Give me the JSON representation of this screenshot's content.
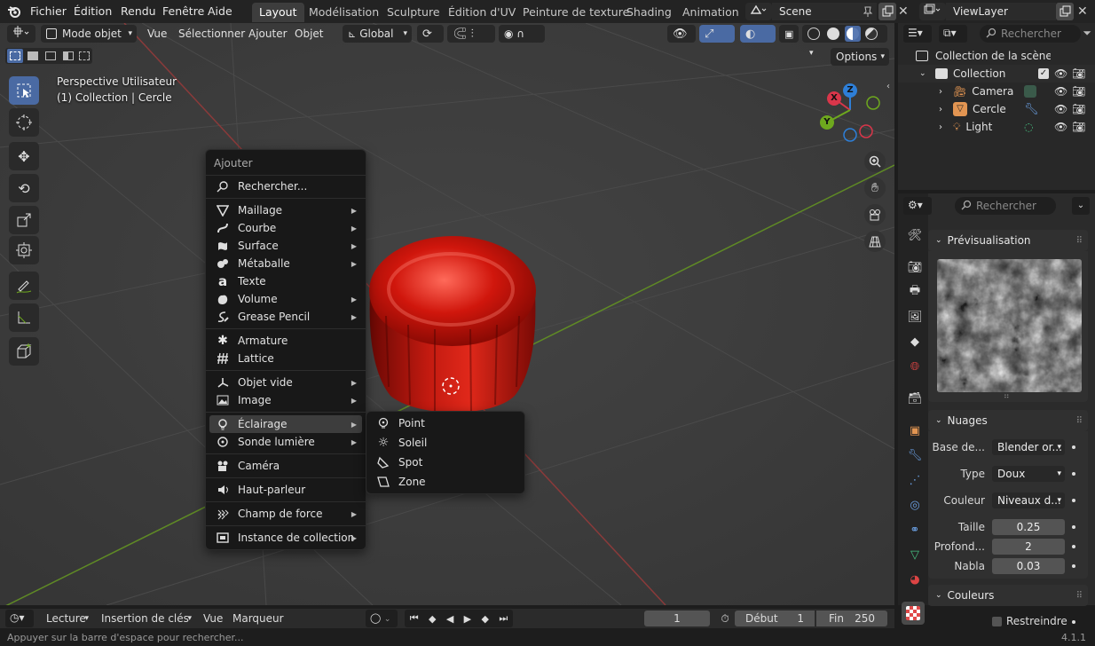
{
  "topbar": {
    "menus": [
      "Fichier",
      "Édition",
      "Rendu",
      "Fenêtre",
      "Aide"
    ],
    "workspaces": [
      "Layout",
      "Modélisation",
      "Sculpture",
      "Édition d'UV",
      "Peinture de texture",
      "Shading",
      "Animation"
    ],
    "active_workspace": "Layout",
    "scene": "Scene",
    "view_layer": "ViewLayer"
  },
  "viewport_header": {
    "mode": "Mode objet",
    "menus": [
      "Vue",
      "Sélectionner",
      "Ajouter",
      "Objet"
    ],
    "orientation": "Global",
    "options": "Options"
  },
  "viewport": {
    "info_line1": "Perspective Utilisateur",
    "info_line2": "(1) Collection | Cercle",
    "gizmo": {
      "x": "X",
      "y": "Y",
      "z": "Z"
    }
  },
  "add_menu": {
    "title": "Ajouter",
    "search": "Rechercher...",
    "items": [
      {
        "label": "Maillage",
        "icon": "mesh-icon",
        "submenu": true
      },
      {
        "label": "Courbe",
        "icon": "curve-icon",
        "submenu": true
      },
      {
        "label": "Surface",
        "icon": "surface-icon",
        "submenu": true
      },
      {
        "label": "Métaballe",
        "icon": "metaball-icon",
        "submenu": true
      },
      {
        "label": "Texte",
        "icon": "text-icon",
        "submenu": false
      },
      {
        "label": "Volume",
        "icon": "volume-icon",
        "submenu": true
      },
      {
        "label": "Grease Pencil",
        "icon": "grease-pencil-icon",
        "submenu": true
      },
      {
        "label": "Armature",
        "icon": "armature-icon",
        "submenu": false
      },
      {
        "label": "Lattice",
        "icon": "lattice-icon",
        "submenu": false
      },
      {
        "label": "Objet vide",
        "icon": "empty-icon",
        "submenu": true
      },
      {
        "label": "Image",
        "icon": "image-icon",
        "submenu": true
      },
      {
        "label": "Éclairage",
        "icon": "light-icon",
        "submenu": true
      },
      {
        "label": "Sonde lumière",
        "icon": "light-probe-icon",
        "submenu": true
      },
      {
        "label": "Caméra",
        "icon": "camera-icon",
        "submenu": false
      },
      {
        "label": "Haut-parleur",
        "icon": "speaker-icon",
        "submenu": false
      },
      {
        "label": "Champ de force",
        "icon": "force-field-icon",
        "submenu": true
      },
      {
        "label": "Instance de collection",
        "icon": "collection-instance-icon",
        "submenu": true
      }
    ],
    "highlighted": "Éclairage"
  },
  "light_submenu": {
    "items": [
      {
        "label": "Point",
        "icon": "point-light-icon"
      },
      {
        "label": "Soleil",
        "icon": "sun-light-icon"
      },
      {
        "label": "Spot",
        "icon": "spot-light-icon"
      },
      {
        "label": "Zone",
        "icon": "area-light-icon"
      }
    ]
  },
  "outliner": {
    "search_placeholder": "Rechercher",
    "root": "Collection de la scène",
    "collection": "Collection",
    "objects": [
      {
        "name": "Camera",
        "icon": "camera-object-icon"
      },
      {
        "name": "Cercle",
        "icon": "mesh-object-icon"
      },
      {
        "name": "Light",
        "icon": "light-object-icon"
      }
    ]
  },
  "properties": {
    "search_placeholder": "Rechercher",
    "preview_title": "Prévisualisation",
    "clouds_title": "Nuages",
    "fields": [
      {
        "label": "Base de...",
        "value": "Blender or...",
        "kind": "dropdown"
      },
      {
        "label": "Type",
        "value": "Doux",
        "kind": "dropdown"
      },
      {
        "label": "Couleur",
        "value": "Niveaux d...",
        "kind": "dropdown"
      },
      {
        "label": "Taille",
        "value": "0.25",
        "kind": "number"
      },
      {
        "label": "Profond...",
        "value": "2",
        "kind": "number"
      },
      {
        "label": "Nabla",
        "value": "0.03",
        "kind": "number"
      }
    ],
    "colors_title": "Couleurs",
    "restrict_label": "Restreindre"
  },
  "timeline": {
    "playback": "Lecture",
    "keying": "Insertion de clés",
    "view": "Vue",
    "marker": "Marqueur",
    "current_frame": "1",
    "start_label": "Début",
    "start": "1",
    "end_label": "Fin",
    "end": "250"
  },
  "status": {
    "hint": "Appuyer sur la barre d'espace pour rechercher...",
    "version": "4.1.1"
  },
  "colors": {
    "accent": "#4a6aa3",
    "object_red": "#c41a10",
    "x_axis": "#d9364a",
    "y_axis": "#6ea81e",
    "z_axis": "#2e7fd8"
  }
}
